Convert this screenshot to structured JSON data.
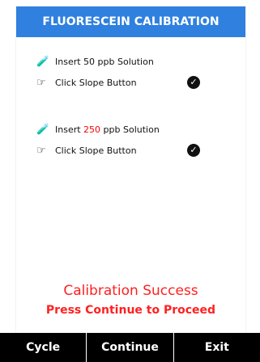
{
  "header": {
    "title": "FLUORESCEIN CALIBRATION"
  },
  "steps": [
    {
      "icon": "pipette-icon",
      "text_before": "Insert ",
      "concentration": "50",
      "concentration_color": "#111111",
      "text_after": " ppb Solution"
    },
    {
      "icon": "hand-pointer-icon",
      "text": "Click Slope Button",
      "checked": true
    },
    {
      "icon": "pipette-icon",
      "text_before": "Insert ",
      "concentration": "250",
      "concentration_color": "#ff0000",
      "text_after": " ppb Solution"
    },
    {
      "icon": "hand-pointer-icon",
      "text": "Click Slope Button",
      "checked": true
    }
  ],
  "status": {
    "title": "Calibration Success",
    "subtitle": "Press Continue to Proceed",
    "color": "#ff2020"
  },
  "softkeys": [
    "Cycle",
    "Continue",
    "Exit"
  ],
  "colors": {
    "header_bg": "#2f80df",
    "softkey_bg": "#000000"
  }
}
